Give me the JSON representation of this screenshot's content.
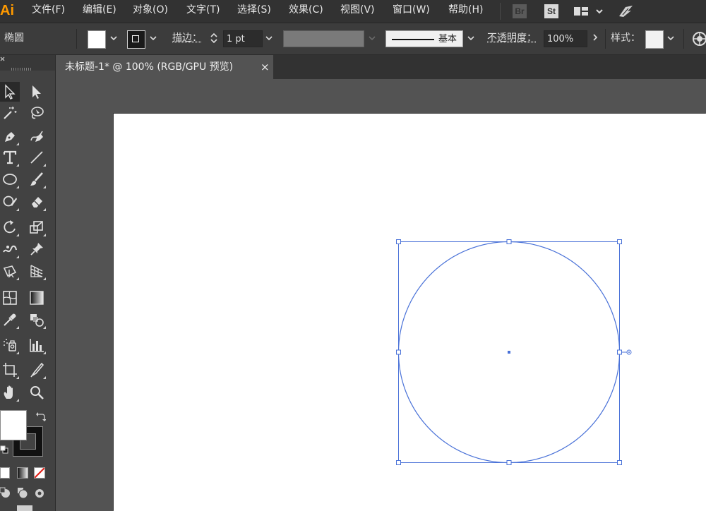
{
  "app": {
    "logo": "Ai"
  },
  "menu": {
    "items": [
      "文件(F)",
      "编辑(E)",
      "对象(O)",
      "文字(T)",
      "选择(S)",
      "效果(C)",
      "视图(V)",
      "窗口(W)",
      "帮助(H)"
    ],
    "bridge_label": "Br",
    "stock_label": "St"
  },
  "control_bar": {
    "object_type": "椭圆",
    "stroke_label": "描边：",
    "stroke_weight": "1 pt",
    "profile_label": "基本",
    "opacity_label": "不透明度：",
    "opacity_value": "100%",
    "style_label": "样式："
  },
  "document": {
    "tab_title": "未标题-1* @ 100% (RGB/GPU 预览)",
    "close_glyph": "×"
  },
  "colors": {
    "accent": "#ff9a00",
    "selection": "#4a72d8",
    "fill": "#ffffff",
    "stroke": "#000000"
  },
  "tools": [
    "selection-tool",
    "direct-selection-tool",
    "magic-wand-tool",
    "lasso-tool",
    "pen-tool",
    "curvature-tool",
    "type-tool",
    "line-segment-tool",
    "ellipse-tool",
    "paintbrush-tool",
    "shaper-tool",
    "eraser-tool",
    "rotate-tool",
    "scale-tool",
    "puppet-warp-tool",
    "pin-tool",
    "free-transform-tool",
    "perspective-grid-tool",
    "mesh-tool",
    "gradient-tool",
    "eyedropper-tool",
    "blend-tool",
    "symbol-sprayer-tool",
    "column-graph-tool",
    "artboard-tool",
    "slice-tool",
    "hand-tool",
    "zoom-tool"
  ]
}
